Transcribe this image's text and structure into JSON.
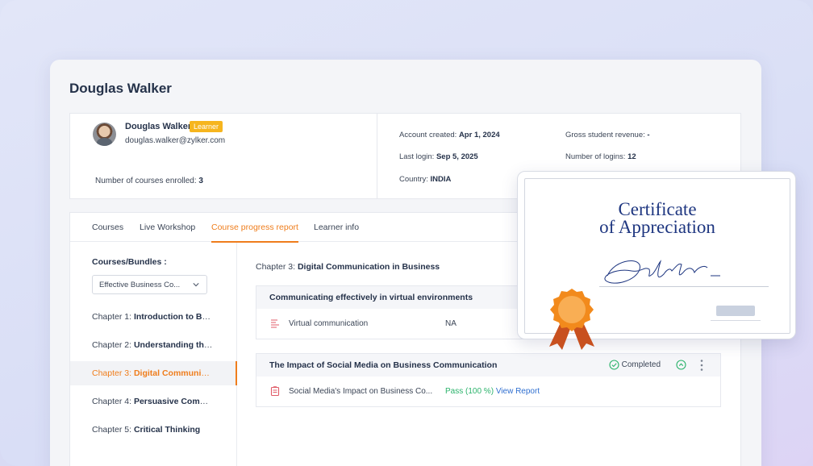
{
  "page": {
    "title": "Douglas Walker"
  },
  "profile": {
    "name": "Douglas Walker",
    "badge": "Learner",
    "email": "douglas.walker@zylker.com",
    "courses_enrolled_label": "Number of courses enrolled:",
    "courses_enrolled_value": "3",
    "account_created_label": "Account created:",
    "account_created_value": "Apr 1, 2024",
    "last_login_label": "Last login:",
    "last_login_value": "Sep 5, 2025",
    "country_label": "Country:",
    "country_value": "INDIA",
    "gross_revenue_label": "Gross student revenue:",
    "gross_revenue_value": "-",
    "num_logins_label": "Number of logins:",
    "num_logins_value": "12"
  },
  "tabs": [
    {
      "label": "Courses",
      "active": false
    },
    {
      "label": "Live Workshop",
      "active": false
    },
    {
      "label": "Course progress report",
      "active": true
    },
    {
      "label": "Learner info",
      "active": false
    }
  ],
  "sidebar": {
    "label": "Courses/Bundles :",
    "selected": "Effective Business Co...",
    "chapters": [
      {
        "prefix": "Chapter 1:",
        "name": "Introduction to Busi..."
      },
      {
        "prefix": "Chapter 2:",
        "name": "Understanding the C..."
      },
      {
        "prefix": "Chapter 3:",
        "name": "Digital Communicati...",
        "active": true
      },
      {
        "prefix": "Chapter 4:",
        "name": "Persuasive Commun..."
      },
      {
        "prefix": "Chapter 5:",
        "name": "Critical Thinking"
      }
    ]
  },
  "content": {
    "chapter_prefix": "Chapter 3:",
    "chapter_name": "Digital Communication in Business",
    "lessons": [
      {
        "title": "Communicating effectively in virtual environments",
        "item_name": "Virtual communication",
        "item_status": "NA"
      },
      {
        "title": "The Impact of Social Media on Business Communication",
        "status": "Completed",
        "item_name": "Social Media's Impact on Business Co...",
        "item_result": "Pass (100 %)",
        "item_link": "View Report"
      }
    ]
  },
  "certificate": {
    "line1": "Certificate",
    "line2": "of Appreciation"
  },
  "colors": {
    "accent": "#ef7d1c",
    "badge": "#f6b51e",
    "pass": "#2bb36b",
    "link": "#2f6fd0",
    "cert_title": "#1e3680"
  },
  "icons": {
    "lesson1": "text-lines-icon",
    "lesson2": "document-icon",
    "completed": "check-circle-icon",
    "collapse": "chevron-up-circle-icon",
    "more": "kebab-menu-icon",
    "dropdown": "chevron-down-icon",
    "award": "award-rosette-icon"
  }
}
